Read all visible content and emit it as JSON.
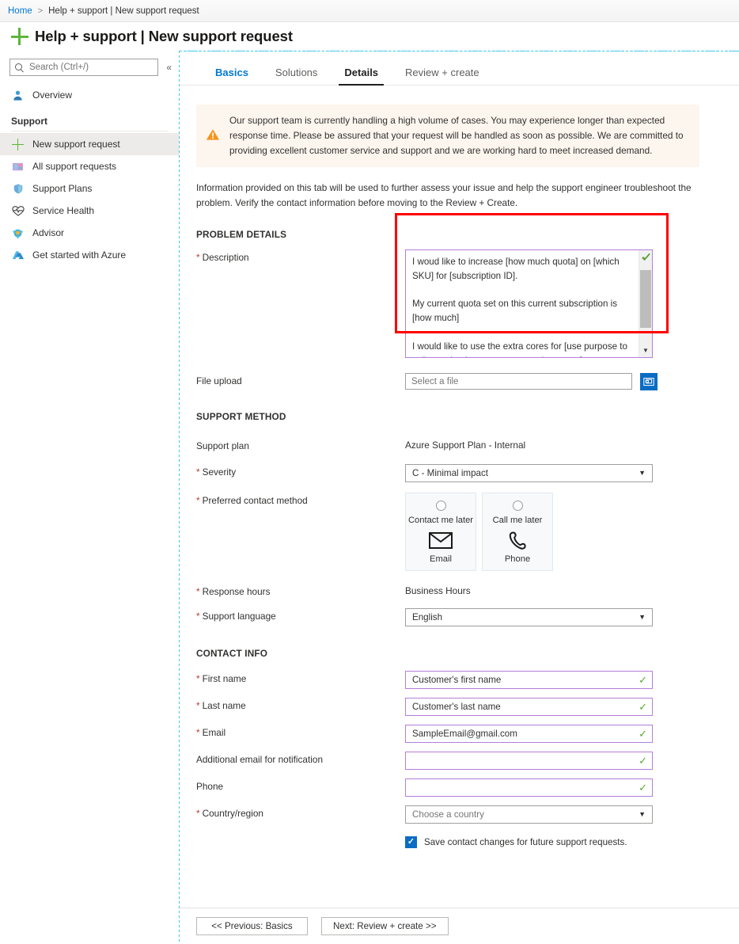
{
  "breadcrumb": {
    "home": "Home",
    "separator": ">",
    "current": "Help + support | New support request"
  },
  "header": {
    "title": "Help + support | New support request",
    "icon": "plus-icon"
  },
  "sidebar": {
    "search": {
      "placeholder": "Search (Ctrl+/)",
      "value": "",
      "icon": "search-icon"
    },
    "collapse_label": "«",
    "items": [
      {
        "label": "Overview",
        "icon": "person-icon",
        "selected": false
      },
      {
        "label": "New support request",
        "icon": "plus-icon",
        "selected": true
      },
      {
        "label": "All support requests",
        "icon": "requests-icon",
        "selected": false
      },
      {
        "label": "Support Plans",
        "icon": "shield-icon",
        "selected": false
      },
      {
        "label": "Service Health",
        "icon": "heart-pulse-icon",
        "selected": false
      },
      {
        "label": "Advisor",
        "icon": "advisor-icon",
        "selected": false
      },
      {
        "label": "Get started with Azure",
        "icon": "azure-icon",
        "selected": false
      }
    ],
    "section_label": "Support"
  },
  "tabs": [
    {
      "label": "Basics",
      "state": "visited"
    },
    {
      "label": "Solutions",
      "state": "normal"
    },
    {
      "label": "Details",
      "state": "active"
    },
    {
      "label": "Review + create",
      "state": "normal"
    }
  ],
  "banner": {
    "icon": "warning-icon",
    "text": "Our support team is currently handling a high volume of cases. You may experience longer than expected response time. Please be assured that your request will be handled as soon as possible. We are committed to providing excellent customer service and support and we are working hard to meet increased demand.",
    "background": "#fdf6ee",
    "icon_color": "#f7941d"
  },
  "intro_text": "Information provided on this tab will be used to further assess your issue and help the support engineer troubleshoot the problem. Verify the contact information before moving to the Review + Create.",
  "problem_details": {
    "heading": "PROBLEM DETAILS",
    "description": {
      "label": "Description",
      "required": true,
      "value": "I woud like to increase [how much quota] on [which SKU] for [subscription ID].\n\nMy current quota set on this current subscription is [how much]\n\nI would like to use the extra cores for [use purpose to call out why the extra cores are important]",
      "spellcheck_icon": "spellcheck-icon",
      "scroll_down_icon": "chevron-down-icon",
      "highlight_color": "#ff0000"
    },
    "file_upload": {
      "label": "File upload",
      "required": false,
      "placeholder": "Select a file",
      "value": "",
      "button_icon": "folder-upload-icon",
      "button_color": "#0a6cc4"
    }
  },
  "support_method": {
    "heading": "SUPPORT METHOD",
    "support_plan": {
      "label": "Support plan",
      "value": "Azure Support Plan - Internal"
    },
    "severity": {
      "label": "Severity",
      "required": true,
      "value": "C - Minimal impact"
    },
    "preferred_contact_method": {
      "label": "Preferred contact method",
      "required": true,
      "options": [
        {
          "top_label": "Contact me later",
          "bottom_label": "Email",
          "icon": "envelope-icon",
          "selected": false
        },
        {
          "top_label": "Call me later",
          "bottom_label": "Phone",
          "icon": "phone-icon",
          "selected": false
        }
      ]
    },
    "response_hours": {
      "label": "Response hours",
      "required": true,
      "value": "Business Hours"
    },
    "support_language": {
      "label": "Support language",
      "required": true,
      "value": "English"
    }
  },
  "contact_info": {
    "heading": "CONTACT INFO",
    "fields": [
      {
        "label": "First name",
        "required": true,
        "value": "Customer's first name",
        "is_placeholder": false,
        "validated": true
      },
      {
        "label": "Last name",
        "required": true,
        "value": "Customer's last name",
        "is_placeholder": false,
        "validated": true
      },
      {
        "label": "Email",
        "required": true,
        "value": "SampleEmail@gmail.com",
        "is_placeholder": false,
        "validated": true
      },
      {
        "label": "Additional email for notification",
        "required": false,
        "value": "",
        "is_placeholder": false,
        "validated": true
      },
      {
        "label": "Phone",
        "required": false,
        "value": "",
        "is_placeholder": false,
        "validated": true
      }
    ],
    "country": {
      "label": "Country/region",
      "required": true,
      "value": "Choose a country"
    },
    "save_checkbox": {
      "label": "Save contact changes for future support requests.",
      "checked": true
    }
  },
  "footer": {
    "previous_label": "<< Previous: Basics",
    "next_label": "Next: Review + create >>"
  }
}
